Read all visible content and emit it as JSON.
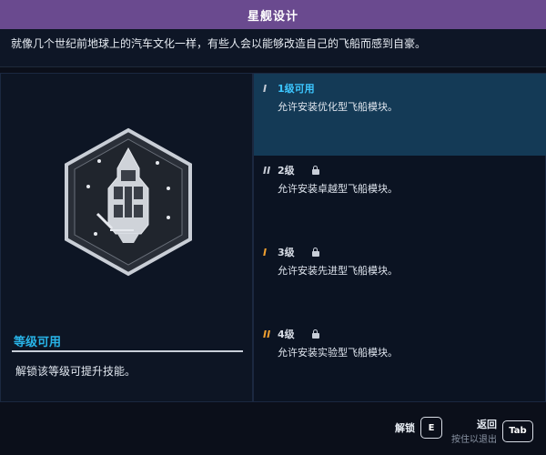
{
  "header": {
    "title": "星舰设计"
  },
  "description": "就像几个世纪前地球上的汽车文化一样，有些人会以能够改造自己的飞船而感到自豪。",
  "left": {
    "badge_icon": "ship-hull-badge-icon",
    "level_status": "等级可用",
    "level_desc": "解锁该等级可提升技能。"
  },
  "tiers": [
    {
      "roman": "I",
      "name": "1级可用",
      "desc": "允许安装优化型飞船模块。",
      "locked": false,
      "active": true
    },
    {
      "roman": "II",
      "name": "2级",
      "desc": "允许安装卓越型飞船模块。",
      "locked": true,
      "active": false
    },
    {
      "roman": "I",
      "name": "3级",
      "desc": "允许安装先进型飞船模块。",
      "locked": true,
      "active": false
    },
    {
      "roman": "II",
      "name": "4级",
      "desc": "允许安装实验型飞船模块。",
      "locked": true,
      "active": false
    }
  ],
  "footer": {
    "unlock_label": "解锁",
    "unlock_key": "E",
    "back_label": "返回",
    "back_sub": "按住以退出",
    "back_key": "Tab"
  },
  "colors": {
    "title_bar": "#6a4a8f",
    "accent": "#28b4e8",
    "active_row": "#143a56",
    "tier_marker": "#f0a030"
  }
}
